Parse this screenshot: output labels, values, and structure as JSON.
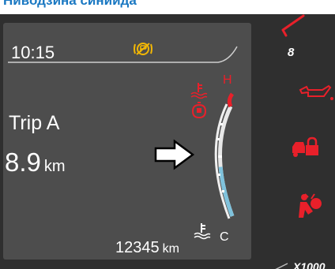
{
  "page_title": "Ниводзина синиида",
  "display": {
    "time": "10:15",
    "trip_label": "Trip A",
    "trip_value": "8.9",
    "trip_unit": "km",
    "odometer_value": "12345",
    "odometer_unit": "km",
    "gauge_high_label": "H",
    "gauge_low_label": "C",
    "temperature_level": 0.45
  },
  "right_strip": {
    "gear_indicator": "8",
    "bottom_code": "X1000"
  },
  "colors": {
    "warning_red": "#e8202a",
    "gauge_blue": "#7fc2dc",
    "parking_yellow": "#f2b705"
  },
  "icons": [
    "parking-brake-warning-icon",
    "coolant-temperature-icon",
    "engine-warning-icon",
    "coolant-low-icon",
    "oil-can-icon",
    "car-lock-icon",
    "airbag-icon",
    "pointer-arrow-icon"
  ]
}
